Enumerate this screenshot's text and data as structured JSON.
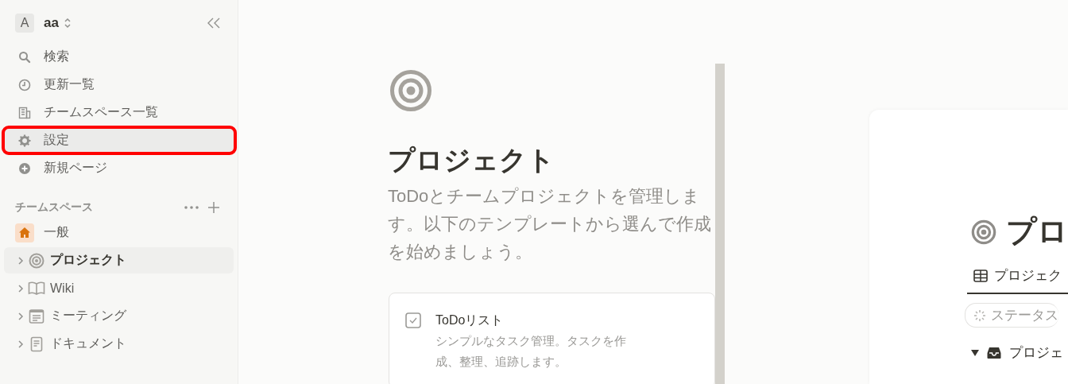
{
  "workspace": {
    "initial": "A",
    "name": "aa"
  },
  "nav": [
    {
      "label": "検索",
      "kind": "search",
      "highlighted": false
    },
    {
      "label": "更新一覧",
      "kind": "clock",
      "highlighted": false
    },
    {
      "label": "チームスペース一覧",
      "kind": "building",
      "highlighted": false
    },
    {
      "label": "設定",
      "kind": "gear",
      "highlighted": true
    },
    {
      "label": "新規ページ",
      "kind": "plus",
      "highlighted": false
    }
  ],
  "teamspaces": {
    "label": "チームスペース",
    "items": [
      {
        "label": "一般",
        "kind": "home",
        "selected": false,
        "expandable": false
      },
      {
        "label": "プロジェクト",
        "kind": "target",
        "selected": true,
        "expandable": true
      },
      {
        "label": "Wiki",
        "kind": "book",
        "selected": false,
        "expandable": true
      },
      {
        "label": "ミーティング",
        "kind": "calendar",
        "selected": false,
        "expandable": true
      },
      {
        "label": "ドキュメント",
        "kind": "doc",
        "selected": false,
        "expandable": true
      }
    ]
  },
  "template_panel": {
    "title": "プロジェクト",
    "description": "ToDoとチームプロジェクトを管理します。以下のテンプレートから選んで作成を始めましょう。",
    "templates": [
      {
        "title": "ToDoリスト",
        "description": "シンプルなタスク管理。タスクを作成、整理、追跡します。"
      }
    ]
  },
  "preview": {
    "title": "プロ",
    "tab": "プロジェク",
    "filter": "ステータス",
    "group": "プロジェ"
  }
}
